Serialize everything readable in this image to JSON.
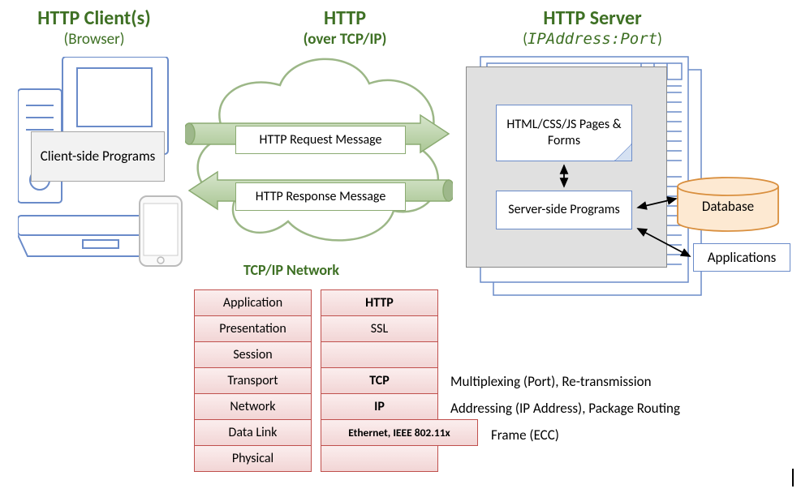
{
  "client": {
    "title": "HTTP Client(s)",
    "subtitle": "(Browser)",
    "programs_label": "Client-side Programs"
  },
  "middle": {
    "title": "HTTP",
    "subtitle": "(over TCP/IP)",
    "request_label": "HTTP Request Message",
    "response_label": "HTTP Response Message",
    "tcpip_title": "TCP/IP Network"
  },
  "server": {
    "title": "HTTP Server",
    "subtitle_open": "(",
    "subtitle_addr": "IPAddress",
    "subtitle_colon": ":",
    "subtitle_port": "Port",
    "subtitle_close": ")",
    "pages_label": "HTML/CSS/JS Pages & Forms",
    "ssp_label": "Server-side Programs",
    "db_label": "Database",
    "apps_label": "Applications"
  },
  "layers": [
    "Application",
    "Presentation",
    "Session",
    "Transport",
    "Network",
    "Data Link",
    "Physical"
  ],
  "protocols": [
    "HTTP",
    "SSL",
    "",
    "TCP",
    "IP",
    "Ethernet, IEEE 802.11x",
    ""
  ],
  "protocol_bold": [
    true,
    false,
    false,
    true,
    true,
    true,
    false
  ],
  "annotations": {
    "transport": "Multiplexing (Port), Re-transmission",
    "network": "Addressing (IP Address), Package Routing",
    "datalink": "Frame (ECC)"
  }
}
